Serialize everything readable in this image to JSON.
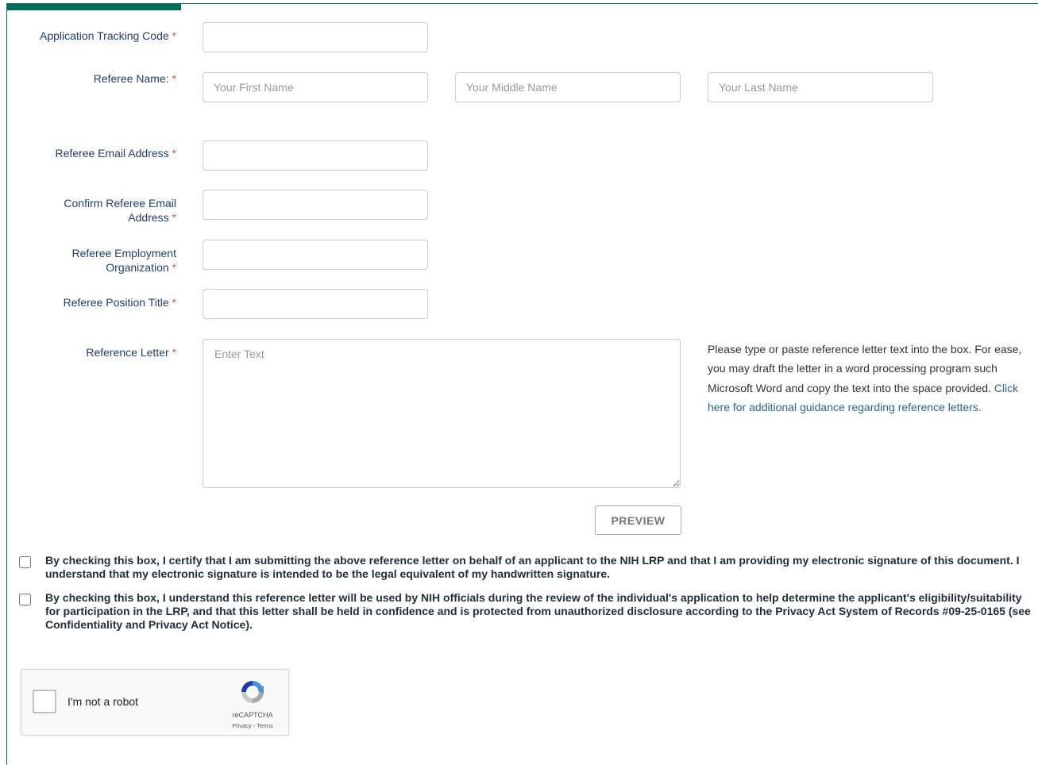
{
  "form": {
    "tracking_code": {
      "label": "Application Tracking Code",
      "required_mark": "*",
      "value": ""
    },
    "referee_name": {
      "label": "Referee Name:",
      "required_mark": "*",
      "first_placeholder": "Your First Name",
      "middle_placeholder": "Your Middle Name",
      "last_placeholder": "Your Last Name"
    },
    "email": {
      "label": "Referee Email Address",
      "required_mark": "*",
      "value": ""
    },
    "confirm_email": {
      "label": "Confirm Referee Email Address",
      "required_mark": "*",
      "value": ""
    },
    "organization": {
      "label": "Referee Employment Organization",
      "required_mark": "*",
      "value": ""
    },
    "position_title": {
      "label": "Referee Position Title",
      "required_mark": "*",
      "value": ""
    },
    "letter": {
      "label": "Reference Letter",
      "required_mark": "*",
      "placeholder": "Enter Text",
      "help_text": "Please type or paste reference letter text into the box. For ease, you may draft the letter in a word processing program such Microsoft Word and copy the text into the space provided.",
      "help_link": "Click here for additional guidance regarding reference letters."
    },
    "preview_button": "PREVIEW"
  },
  "certifications": [
    {
      "text": "By checking this box, I certify that I am submitting the above reference letter on behalf of an applicant to the NIH LRP and that I am providing my electronic signature of this document. I understand that my electronic signature is intended to be the legal equivalent of my handwritten signature.",
      "checked": false
    },
    {
      "text": "By checking this box, I understand this reference letter will be used by NIH officials during the review of the individual's application to help determine the applicant's eligibility/suitability for participation in the LRP, and that this letter shall be held in confidence and is protected from unauthorized disclosure according to the Privacy Act System of Records #09-25-0165 (see Confidentiality and Privacy Act Notice).",
      "checked": false
    }
  ],
  "captcha": {
    "label": "I'm not a robot",
    "brand": "reCAPTCHA",
    "privacy": "Privacy",
    "separator": "-",
    "terms": "Terms",
    "icon": "recaptcha-logo-icon"
  },
  "colors": {
    "frame": "#006d5b",
    "label_text": "#1f3e6f",
    "required": "#d9534f",
    "link": "#2a6496"
  }
}
